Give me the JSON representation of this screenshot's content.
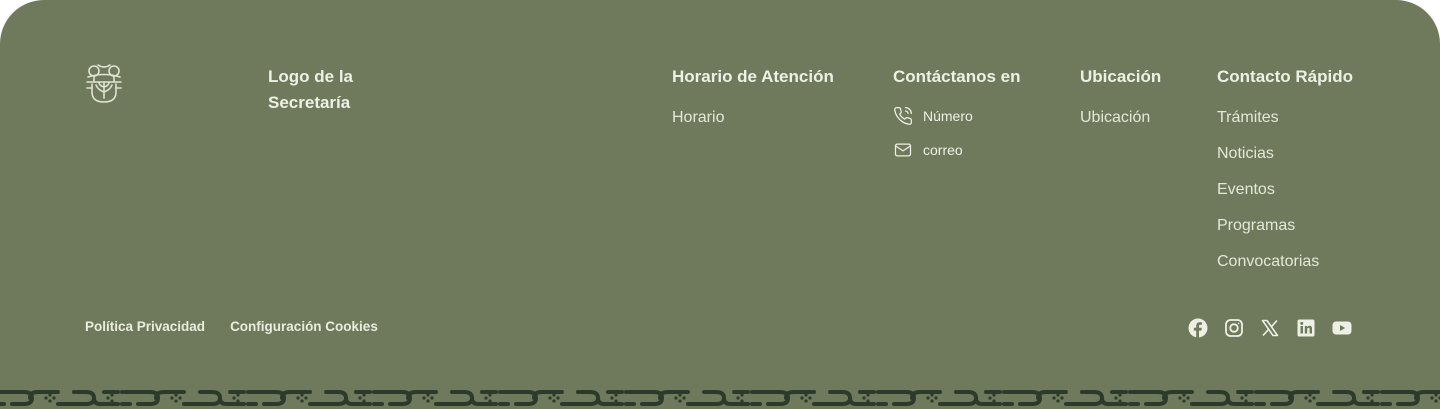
{
  "colors": {
    "background": "#6e7a5b",
    "text": "#e9ecdf",
    "pattern_dark": "#2b3a2a"
  },
  "logo": {
    "icon": "emblem-icon",
    "text": "Logo de la Secretaría"
  },
  "horario": {
    "title": "Horario de Atención",
    "items": [
      "Horario"
    ]
  },
  "contacto": {
    "title": "Contáctanos en",
    "phone": {
      "icon": "phone-icon",
      "label": "Número"
    },
    "email": {
      "icon": "mail-icon",
      "label": "correo"
    }
  },
  "ubicacion": {
    "title": "Ubicación",
    "items": [
      "Ubicación"
    ]
  },
  "contacto_rapido": {
    "title": "Contacto Rápido",
    "items": [
      "Trámites",
      "Noticias",
      "Eventos",
      "Programas",
      "Convocatorias"
    ]
  },
  "legal": {
    "privacy": "Política Privacidad",
    "cookies": "Configuración Cookies"
  },
  "social": [
    "facebook-icon",
    "instagram-icon",
    "x-icon",
    "linkedin-icon",
    "youtube-icon"
  ]
}
